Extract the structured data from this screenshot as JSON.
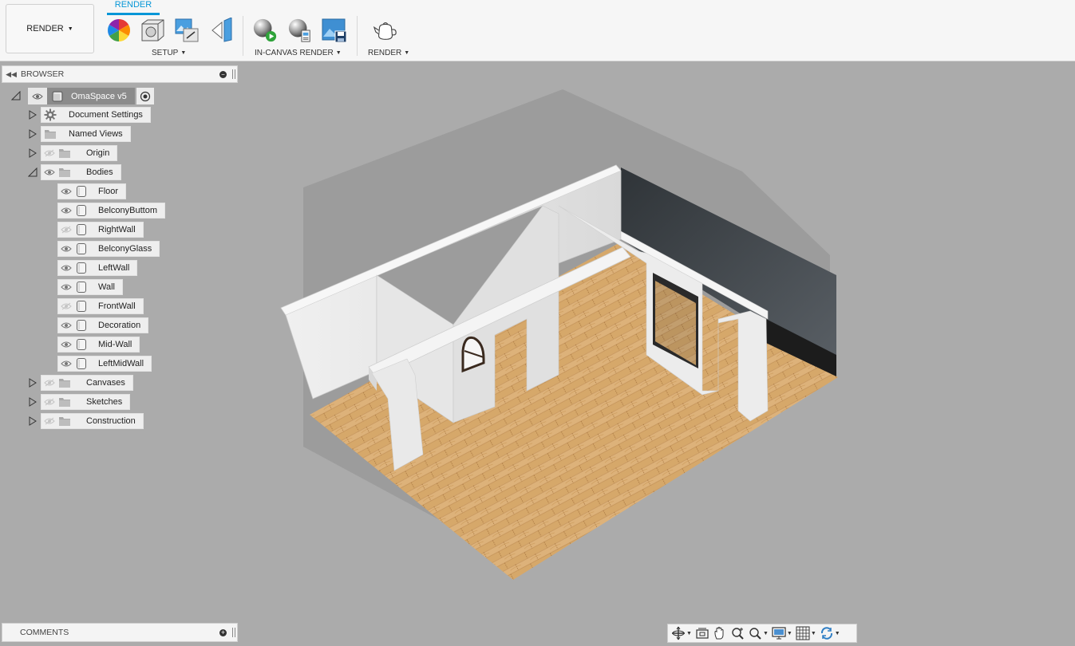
{
  "toolbar": {
    "workspace_label": "RENDER",
    "active_tab": "RENDER",
    "groups": {
      "setup": "SETUP",
      "in_canvas": "IN-CANVAS RENDER",
      "render": "RENDER"
    },
    "tools": [
      "scene-settings-icon",
      "appearance-icon",
      "texture-map-icon",
      "decal-icon",
      "in-canvas-render-icon",
      "in-canvas-settings-icon",
      "capture-image-icon",
      "render-teapot-icon"
    ]
  },
  "browser": {
    "title": "BROWSER",
    "root": "OmaSpace v5",
    "items": [
      {
        "label": "Document Settings",
        "icon": "gear-icon"
      },
      {
        "label": "Named Views",
        "icon": "folder-icon"
      },
      {
        "label": "Origin",
        "icon": "folder-icon",
        "hidden": true
      },
      {
        "label": "Bodies",
        "icon": "folder-icon",
        "expanded": true
      }
    ],
    "bodies": [
      {
        "label": "Floor",
        "hidden": false
      },
      {
        "label": "BelconyButtom",
        "hidden": false
      },
      {
        "label": "RightWall",
        "hidden": true
      },
      {
        "label": "BelconyGlass",
        "hidden": false
      },
      {
        "label": "LeftWall",
        "hidden": false
      },
      {
        "label": "Wall",
        "hidden": false
      },
      {
        "label": "FrontWall",
        "hidden": true
      },
      {
        "label": "Decoration",
        "hidden": false
      },
      {
        "label": "Mid-Wall",
        "hidden": false
      },
      {
        "label": "LeftMidWall",
        "hidden": false
      }
    ],
    "after": [
      {
        "label": "Canvases",
        "icon": "folder-icon",
        "hidden": true
      },
      {
        "label": "Sketches",
        "icon": "folder-icon",
        "hidden": true
      },
      {
        "label": "Construction",
        "icon": "folder-icon",
        "hidden": true
      }
    ]
  },
  "comments": {
    "title": "COMMENTS"
  },
  "navbar": [
    "orbit-icon",
    "look-at-icon",
    "pan-hand-icon",
    "zoom-icon",
    "zoom-window-icon",
    "display-settings-icon",
    "grid-icon",
    "viewports-icon"
  ],
  "colors": {
    "accent": "#0696d7",
    "canvas": "#ababab",
    "panel": "#f4f4f4"
  }
}
